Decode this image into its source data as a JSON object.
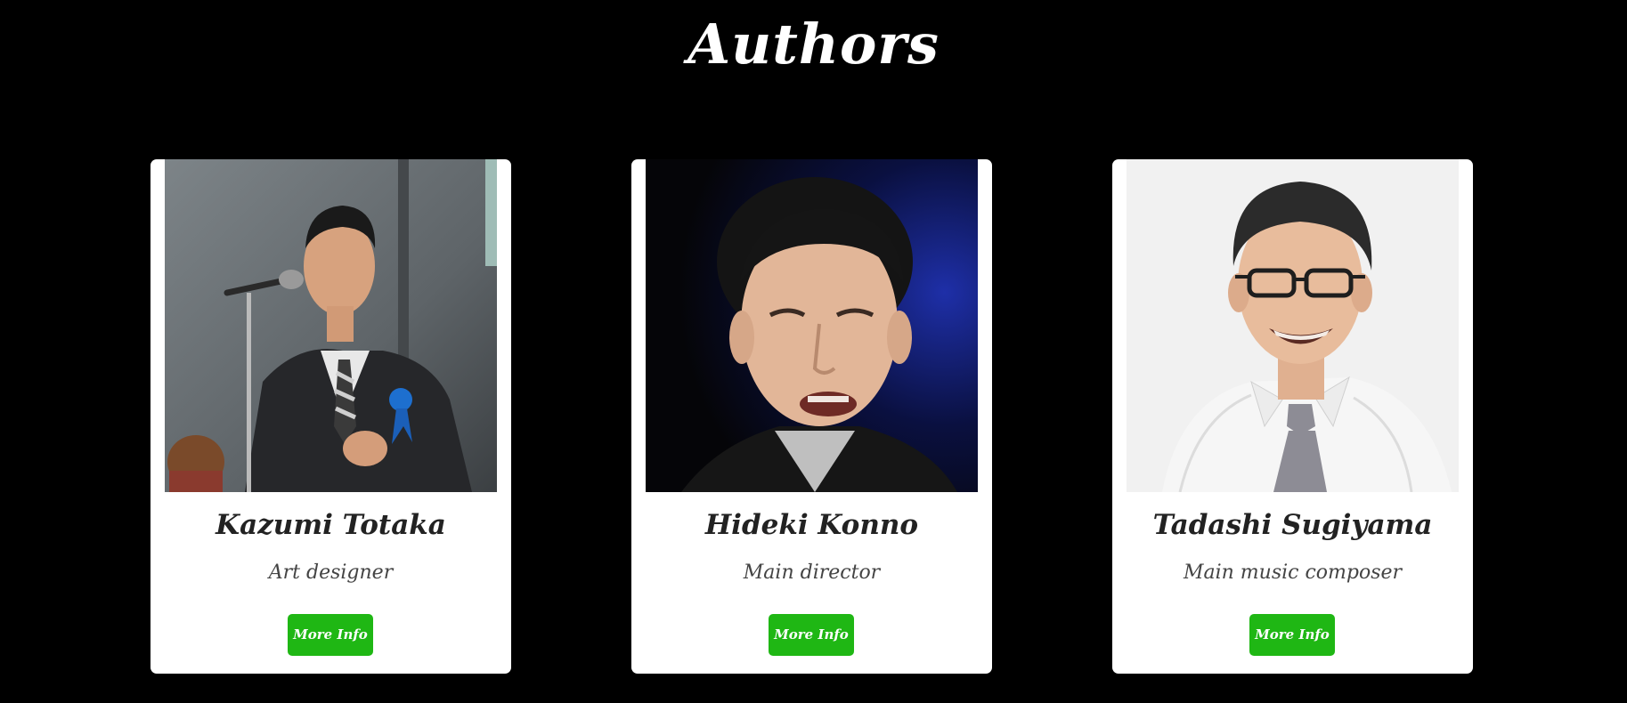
{
  "page": {
    "title": "Authors"
  },
  "authors": [
    {
      "name": "Kazumi Totaka",
      "role": "Art designer",
      "button_label": "More Info",
      "photo_icon": "man-at-microphone-photo"
    },
    {
      "name": "Hideki Konno",
      "role": "Main director",
      "button_label": "More Info",
      "photo_icon": "man-speaking-portrait-photo"
    },
    {
      "name": "Tadashi Sugiyama",
      "role": "Main music composer",
      "button_label": "More Info",
      "photo_icon": "smiling-man-with-glasses-photo"
    }
  ],
  "colors": {
    "background": "#000000",
    "card": "#ffffff",
    "button": "#1fb714",
    "title": "#ffffff"
  }
}
